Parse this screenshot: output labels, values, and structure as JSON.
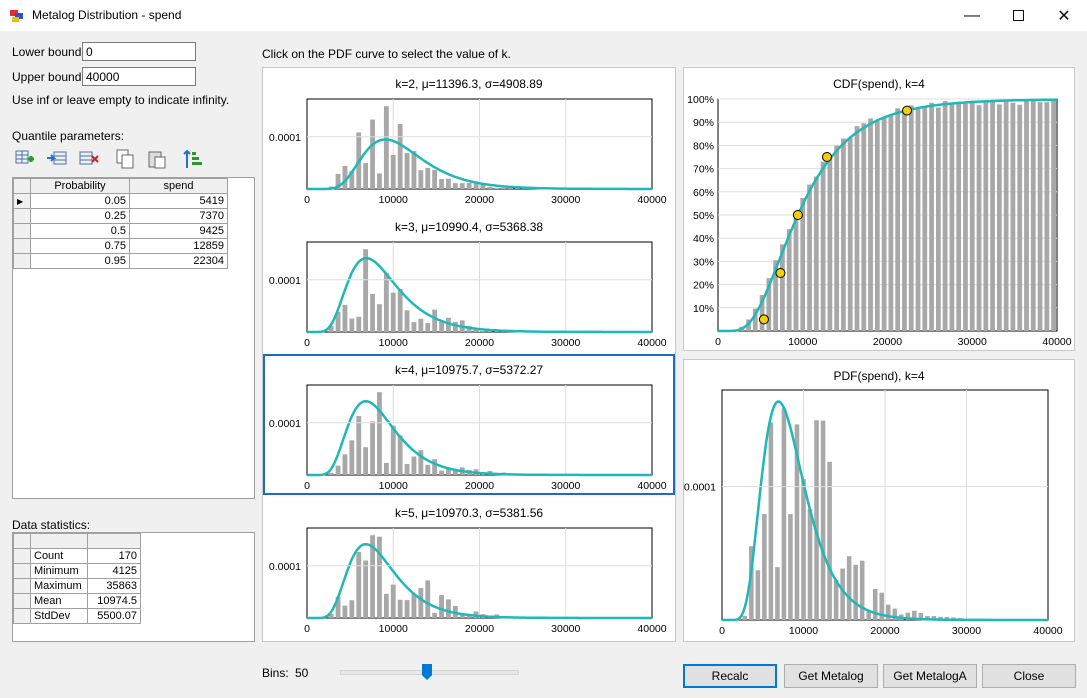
{
  "window": {
    "title": "Metalog Distribution - spend"
  },
  "bounds": {
    "lower_label": "Lower bound:",
    "lower_value": "0",
    "upper_label": "Upper bound:",
    "upper_value": "40000",
    "hint": "Use inf or leave empty to indicate infinity."
  },
  "quantile": {
    "label": "Quantile parameters:",
    "columns": [
      "Probability",
      "spend"
    ],
    "rows": [
      [
        "0.05",
        "5419"
      ],
      [
        "0.25",
        "7370"
      ],
      [
        "0.5",
        "9425"
      ],
      [
        "0.75",
        "12859"
      ],
      [
        "0.95",
        "22304"
      ]
    ]
  },
  "stats": {
    "label": "Data statistics:",
    "rows": [
      [
        "Count",
        "170"
      ],
      [
        "Minimum",
        "4125"
      ],
      [
        "Maximum",
        "35863"
      ],
      [
        "Mean",
        "10974.5"
      ],
      [
        "StdDev",
        "5500.07"
      ]
    ]
  },
  "instruction": "Click on the PDF curve to select the value of k.",
  "bins": {
    "label": "Bins:",
    "value": "50",
    "fraction": 0.5
  },
  "buttons": {
    "recalc": "Recalc",
    "get_metalog": "Get Metalog",
    "get_metaloga": "Get MetalogA",
    "close": "Close"
  },
  "colors": {
    "curve": "#1fb8b8",
    "bar": "#a8a8a8",
    "point": "#f5d000",
    "select": "#1c6cbf"
  },
  "chart_data": [
    {
      "type": "bar",
      "title": "k=2, μ=11396.3, σ=4908.89",
      "ytick": "0.0001",
      "xticks": [
        "0",
        "10000",
        "20000",
        "30000",
        "40000"
      ],
      "xlim": [
        0,
        40000
      ]
    },
    {
      "type": "bar",
      "title": "k=3, μ=10990.4, σ=5368.38",
      "ytick": "0.0001",
      "xticks": [
        "0",
        "10000",
        "20000",
        "30000",
        "40000"
      ],
      "xlim": [
        0,
        40000
      ]
    },
    {
      "type": "bar",
      "title": "k=4, μ=10975.7, σ=5372.27",
      "ytick": "0.0001",
      "xticks": [
        "0",
        "10000",
        "20000",
        "30000",
        "40000"
      ],
      "xlim": [
        0,
        40000
      ]
    },
    {
      "type": "bar",
      "title": "k=5, μ=10970.3, σ=5381.56",
      "ytick": "0.0001",
      "xticks": [
        "0",
        "10000",
        "20000",
        "30000",
        "40000"
      ],
      "xlim": [
        0,
        40000
      ]
    },
    {
      "type": "line",
      "title": "CDF(spend), k=4",
      "xticks": [
        "0",
        "10000",
        "20000",
        "30000",
        "40000"
      ],
      "yticks": [
        "10%",
        "20%",
        "30%",
        "40%",
        "50%",
        "60%",
        "70%",
        "80%",
        "90%",
        "100%"
      ],
      "xlim": [
        0,
        40000
      ],
      "ylim": [
        0,
        1
      ],
      "points": [
        [
          5419,
          0.05
        ],
        [
          7370,
          0.25
        ],
        [
          9425,
          0.5
        ],
        [
          12859,
          0.75
        ],
        [
          22304,
          0.95
        ]
      ]
    },
    {
      "type": "bar",
      "title": "PDF(spend), k=4",
      "ytick": "0.0001",
      "xticks": [
        "0",
        "10000",
        "20000",
        "30000",
        "40000"
      ],
      "xlim": [
        0,
        40000
      ]
    }
  ]
}
